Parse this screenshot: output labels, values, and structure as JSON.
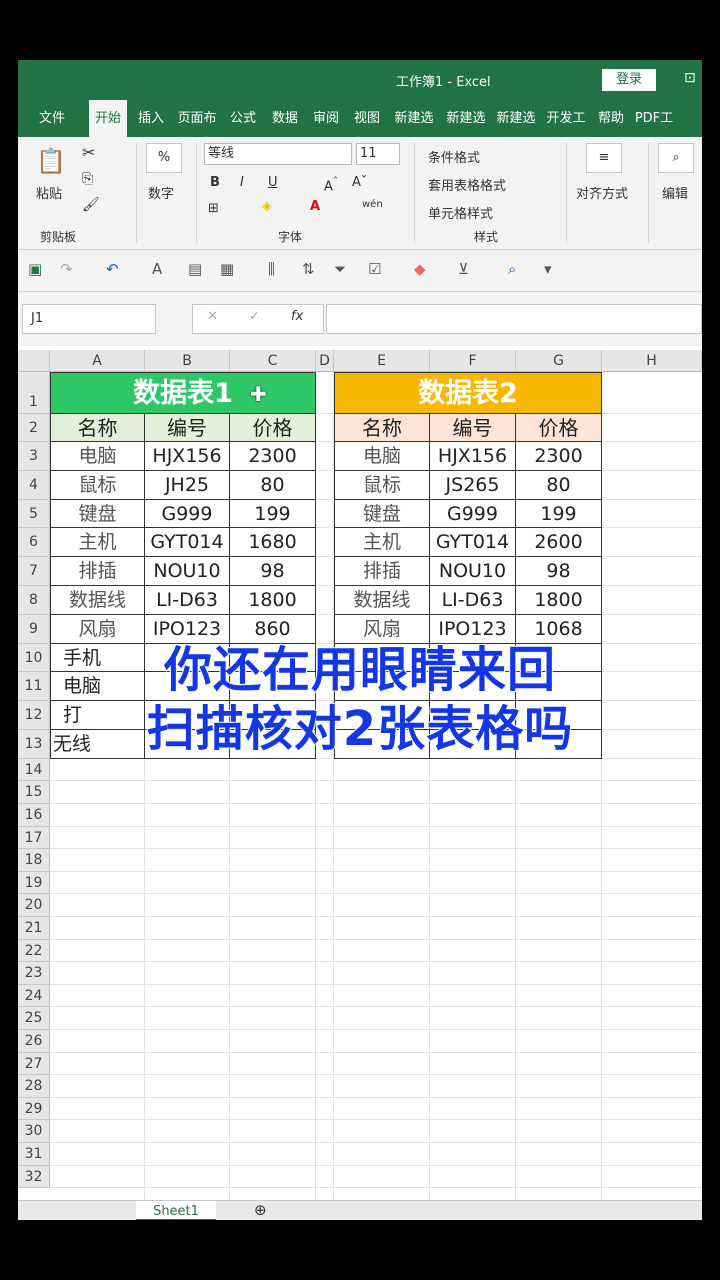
{
  "titlebar": {
    "title": "工作簿1  -  Excel",
    "login": "登录"
  },
  "tabs": [
    "文件",
    "开始",
    "插入",
    "页面布",
    "公式",
    "数据",
    "审阅",
    "视图",
    "新建选",
    "新建选",
    "新建选",
    "开发工",
    "帮助",
    "PDF工"
  ],
  "ribbon": {
    "paste": "粘贴",
    "clipboard": "剪贴板",
    "number": "数字",
    "font_name": "等线",
    "font_size": "11",
    "font_group": "字体",
    "cond_format": "条件格式",
    "table_format": "套用表格格式",
    "cell_style": "单元格样式",
    "style_group": "样式",
    "align": "对齐方式",
    "edit": "编辑",
    "bold": "B",
    "italic": "I",
    "underline": "U",
    "wen": "wén"
  },
  "namebox": "J1",
  "columns": [
    "A",
    "B",
    "C",
    "D",
    "E",
    "F",
    "G",
    "H"
  ],
  "rows": [
    "1",
    "2",
    "3",
    "4",
    "5",
    "6",
    "7",
    "8",
    "9",
    "10",
    "11",
    "12",
    "13",
    "14",
    "15",
    "16",
    "17",
    "18",
    "19",
    "20",
    "21",
    "22",
    "23",
    "24",
    "25",
    "26",
    "27",
    "28",
    "29",
    "30",
    "31",
    "32"
  ],
  "table1": {
    "title": "数据表1",
    "headers": [
      "名称",
      "编号",
      "价格"
    ],
    "rows": [
      [
        "电脑",
        "HJX156",
        "2300"
      ],
      [
        "鼠标",
        "JH25",
        "80"
      ],
      [
        "键盘",
        "G999",
        "199"
      ],
      [
        "主机",
        "GYT014",
        "1680"
      ],
      [
        "排插",
        "NOU10",
        "98"
      ],
      [
        "数据线",
        "LI-D63",
        "1800"
      ],
      [
        "风扇",
        "IPO123",
        "860"
      ],
      [
        "手机",
        "",
        ""
      ],
      [
        "电脑",
        "",
        ""
      ],
      [
        "打",
        "",
        ""
      ],
      [
        "无线",
        "",
        ""
      ]
    ]
  },
  "table2": {
    "title": "数据表2",
    "headers": [
      "名称",
      "编号",
      "价格"
    ],
    "rows": [
      [
        "电脑",
        "HJX156",
        "2300"
      ],
      [
        "鼠标",
        "JS265",
        "80"
      ],
      [
        "键盘",
        "G999",
        "199"
      ],
      [
        "主机",
        "GYT014",
        "2600"
      ],
      [
        "排插",
        "NOU10",
        "98"
      ],
      [
        "数据线",
        "LI-D63",
        "1800"
      ],
      [
        "风扇",
        "IPO123",
        "1068"
      ],
      [
        "",
        "",
        ""
      ],
      [
        "",
        "",
        ""
      ],
      [
        "",
        "",
        ""
      ],
      [
        "",
        "",
        ""
      ]
    ]
  },
  "overlay": {
    "line1": "你还在用眼睛来回",
    "line2": "扫描核对2张表格吗"
  },
  "sheet_tab": "Sheet1",
  "colors": {
    "excel_green": "#217346",
    "table1_title": "#2ec767",
    "table1_header": "#e2efda",
    "table2_title": "#f7b800",
    "table2_header": "#fde4d6",
    "overlay_text": "#1437e6"
  }
}
